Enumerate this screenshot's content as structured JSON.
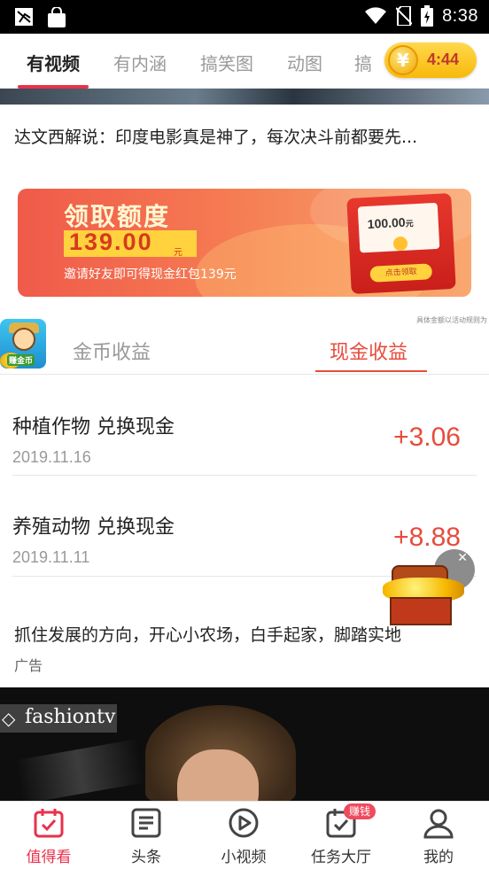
{
  "status_bar": {
    "time": "8:38",
    "icons": [
      "notification-app-icon",
      "shopping-bag-icon",
      "wifi-icon",
      "no-sim-icon",
      "battery-charging-icon"
    ]
  },
  "tabs": [
    {
      "label": "有视频",
      "active": true
    },
    {
      "label": "有内涵",
      "active": false
    },
    {
      "label": "搞笑图",
      "active": false
    },
    {
      "label": "动图",
      "active": false
    },
    {
      "label": "搞",
      "active": false
    }
  ],
  "coin_timer": {
    "symbol": "¥",
    "time": "4:44"
  },
  "headline": "达文西解说：印度电影真是神了，每次决斗前都要先...",
  "banner": {
    "title": "领取额度",
    "amount": "139.00",
    "unit": "元",
    "subtitle": "邀请好友即可得现金红包139元",
    "envelope_amount": "100.00",
    "envelope_unit": "元",
    "envelope_button": "点击领取",
    "disclaimer": "具体金额以活动规则为"
  },
  "earnings": {
    "game_badge": "赚金币",
    "tab_coin": "金币收益",
    "tab_cash": "现金收益",
    "rows": [
      {
        "title": "种植作物 兑换现金",
        "date": "2019.11.16",
        "amount": "+3.06"
      },
      {
        "title": "养殖动物 兑换现金",
        "date": "2019.11.11",
        "amount": "+8.88"
      }
    ]
  },
  "ad": {
    "text": "抓住发展的方向，开心小农场，白手起家，脚踏实地",
    "label": "广告"
  },
  "video": {
    "brand": "fashiontv"
  },
  "bottom_nav": [
    {
      "label": "值得看",
      "icon": "calendar-check-icon",
      "active": true
    },
    {
      "label": "头条",
      "icon": "document-lines-icon",
      "active": false
    },
    {
      "label": "小视频",
      "icon": "play-circle-icon",
      "active": false
    },
    {
      "label": "任务大厅",
      "icon": "calendar-task-icon",
      "active": false,
      "badge": "赚钱"
    },
    {
      "label": "我的",
      "icon": "user-icon",
      "active": false
    }
  ],
  "colors": {
    "accent": "#e8324c",
    "gain": "#e74c3c",
    "muted": "#999999"
  }
}
